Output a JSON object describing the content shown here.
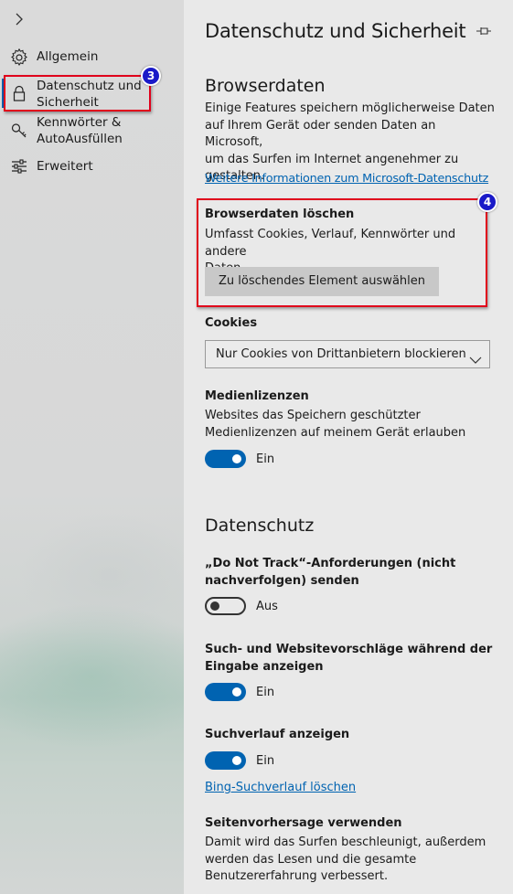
{
  "sidebar": {
    "items": [
      {
        "label": "Allgemein",
        "icon": "gear-icon"
      },
      {
        "label_line1": "Datenschutz und",
        "label_line2": "Sicherheit",
        "icon": "lock-icon",
        "selected": true
      },
      {
        "label_line1": "Kennwörter &",
        "label_line2": "AutoAusfüllen",
        "icon": "key-icon"
      },
      {
        "label": "Erweitert",
        "icon": "sliders-icon"
      }
    ]
  },
  "annotations": {
    "badge_sidebar": "3",
    "badge_main": "4",
    "color": "#e0001b",
    "badge_color": "#1a1ac8"
  },
  "main": {
    "title": "Datenschutz und Sicherheit",
    "browserdaten": {
      "heading": "Browserdaten",
      "desc_lines": [
        "Einige Features speichern möglicherweise Daten",
        "auf Ihrem Gerät oder senden Daten an Microsoft,",
        "um das Surfen im Internet angenehmer zu",
        "gestalten."
      ],
      "link": "Weitere Informationen zum Microsoft-Datenschutz",
      "clear_heading": "Browserdaten löschen",
      "clear_desc_lines": [
        "Umfasst Cookies, Verlauf, Kennwörter und andere",
        "Daten"
      ],
      "clear_button": "Zu löschendes Element auswählen"
    },
    "cookies": {
      "label": "Cookies",
      "selected": "Nur Cookies von Drittanbietern blockieren"
    },
    "medienlizenzen": {
      "label": "Medienlizenzen",
      "desc_lines": [
        "Websites das Speichern geschützter",
        "Medienlizenzen auf meinem Gerät erlauben"
      ],
      "toggle_label": "Ein",
      "on": true
    },
    "datenschutz": {
      "heading": "Datenschutz",
      "dnt_lines": [
        "„Do Not Track“-Anforderungen (nicht",
        "nachverfolgen) senden"
      ],
      "dnt_toggle": "Aus",
      "suggest_lines": [
        "Such- und Websitevorschläge während der",
        "Eingabe anzeigen"
      ],
      "suggest_toggle": "Ein",
      "history_label": "Suchverlauf anzeigen",
      "history_toggle": "Ein",
      "history_link": "Bing-Suchverlauf löschen",
      "predict_label": "Seitenvorhersage verwenden",
      "predict_desc_lines": [
        "Damit wird das Surfen beschleunigt, außerdem",
        "werden das Lesen und die gesamte",
        "Benutzererfahrung verbessert."
      ]
    }
  },
  "colors": {
    "accent": "#0063b1",
    "link": "#0063b1",
    "panel_bg": "#e9e9e9"
  }
}
